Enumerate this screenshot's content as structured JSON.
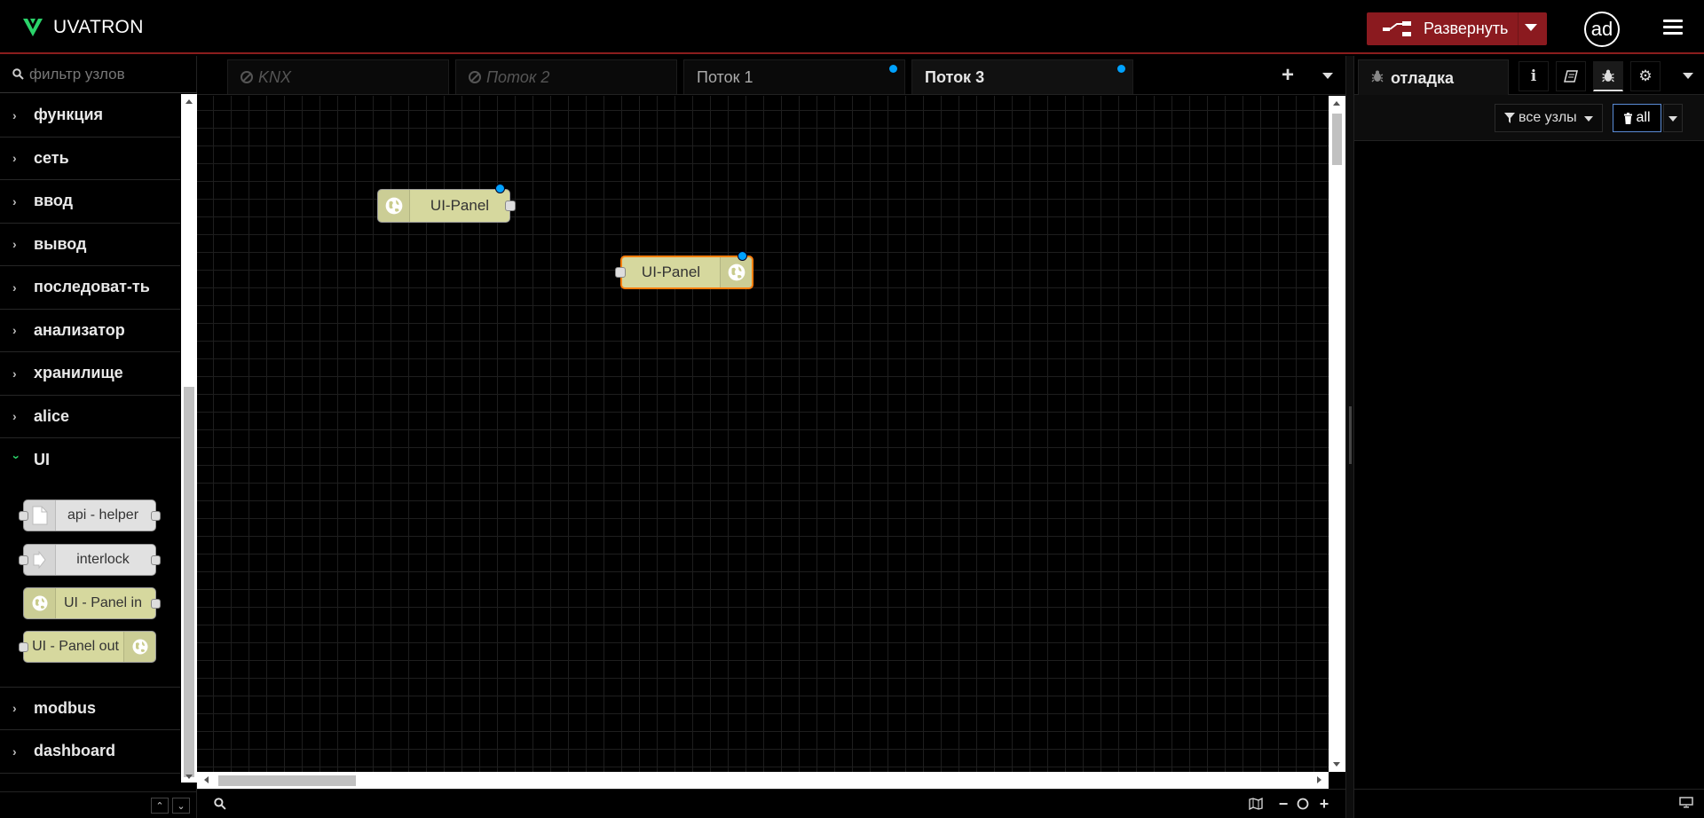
{
  "header": {
    "app_name": "UVATRON",
    "deploy_label": "Развернуть",
    "user_initials": "ad",
    "accent_color": "#8b1a1f",
    "logo_color": "#2bd36a"
  },
  "palette": {
    "search_placeholder": "фильтр узлов",
    "categories_before": [
      {
        "label": "функция"
      },
      {
        "label": "сеть"
      },
      {
        "label": "ввод"
      },
      {
        "label": "вывод"
      },
      {
        "label": "последоват-ть"
      },
      {
        "label": "анализатор"
      },
      {
        "label": "хранилище"
      },
      {
        "label": "alice"
      }
    ],
    "open_category": {
      "label": "UI"
    },
    "ui_nodes": [
      {
        "label": "api - helper",
        "icon": "file-icon",
        "color": "#e1e1e1"
      },
      {
        "label": "interlock",
        "icon": "arrow-in-icon",
        "color": "#e1e1e1"
      },
      {
        "label": "UI - Panel in",
        "icon": "globe-icon",
        "color": "#d6d89e"
      },
      {
        "label": "UI - Panel out",
        "icon": "globe-icon",
        "color": "#d6d89e"
      }
    ],
    "categories_after": [
      {
        "label": "modbus"
      },
      {
        "label": "dashboard"
      }
    ]
  },
  "workspace": {
    "tabs": [
      {
        "label": "KNX",
        "disabled": true
      },
      {
        "label": "Поток 2",
        "disabled": true
      },
      {
        "label": "Поток 1",
        "changed": true
      },
      {
        "label": "Поток 3",
        "changed": true,
        "active": true
      }
    ],
    "nodes": [
      {
        "label": "UI-Panel",
        "type": "input",
        "changed": true,
        "selected": false
      },
      {
        "label": "UI-Panel",
        "type": "output",
        "changed": true,
        "selected": true
      }
    ]
  },
  "sidebar": {
    "active_tab": "отладка",
    "filter_label": "все узлы",
    "clear_label": "all",
    "tab_icons": [
      "info-icon",
      "book-icon",
      "bug-icon",
      "gear-icon"
    ]
  }
}
